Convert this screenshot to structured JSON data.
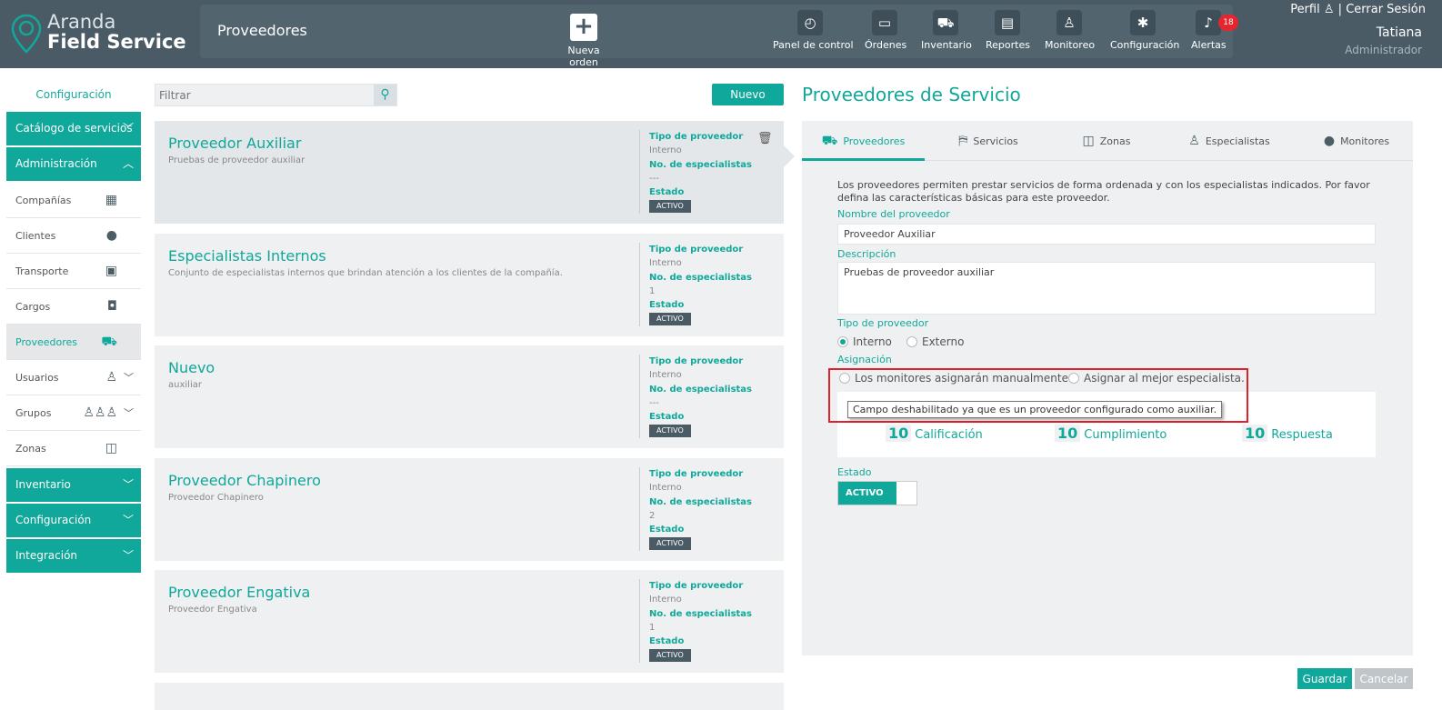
{
  "app": {
    "logo_line1": "Aranda",
    "logo_line2": "Field Service"
  },
  "header": {
    "page_title": "Proveedores",
    "new_order": "Nueva orden",
    "nav": [
      {
        "label": "Panel de control",
        "icon": "dashboard-icon"
      },
      {
        "label": "Órdenes",
        "icon": "orders-icon"
      },
      {
        "label": "Inventario",
        "icon": "inventory-icon"
      },
      {
        "label": "Reportes",
        "icon": "reports-icon"
      },
      {
        "label": "Monitoreo",
        "icon": "monitoring-icon"
      },
      {
        "label": "Configuración",
        "icon": "gear-icon"
      },
      {
        "label": "Alertas",
        "icon": "bell-icon"
      }
    ],
    "alerts_count": "18",
    "profile": "Perfil",
    "separator": "|",
    "logout": "Cerrar Sesión",
    "user_name": "Tatiana",
    "user_role": "Administrador"
  },
  "sidebar": {
    "config_link": "Configuración",
    "catalog": "Catálogo de servicios",
    "admin": "Administración",
    "items": [
      {
        "label": "Compañías",
        "icon": "building-icon"
      },
      {
        "label": "Clientes",
        "icon": "user-icon"
      },
      {
        "label": "Transporte",
        "icon": "bus-icon"
      },
      {
        "label": "Cargos",
        "icon": "briefcase-icon"
      },
      {
        "label": "Proveedores",
        "icon": "cart-icon"
      },
      {
        "label": "Usuarios",
        "icon": "person-icon"
      },
      {
        "label": "Grupos",
        "icon": "group-icon"
      },
      {
        "label": "Zonas",
        "icon": "map-icon"
      }
    ],
    "inventario": "Inventario",
    "configuracion": "Configuración",
    "integracion": "Integración"
  },
  "list": {
    "filter_placeholder": "Filtrar",
    "new_button": "Nuevo",
    "label_tipo": "Tipo de proveedor",
    "label_num": "No. de especialistas",
    "label_estado": "Estado",
    "cards": [
      {
        "title": "Proveedor Auxiliar",
        "desc": "Pruebas de proveedor auxiliar",
        "tipo": "Interno",
        "num": "---",
        "estado": "ACTIVO"
      },
      {
        "title": "Especialistas Internos",
        "desc": "Conjunto de especialistas internos que brindan atención a los clientes de la compañía.",
        "tipo": "Interno",
        "num": "1",
        "estado": "ACTIVO"
      },
      {
        "title": "Nuevo",
        "desc": "auxiliar",
        "tipo": "Interno",
        "num": "---",
        "estado": "ACTIVO"
      },
      {
        "title": "Proveedor Chapinero",
        "desc": "Proveedor Chapinero",
        "tipo": "Interno",
        "num": "2",
        "estado": "ACTIVO"
      },
      {
        "title": "Proveedor Engativa",
        "desc": "Proveedor Engativa",
        "tipo": "Interno",
        "num": "1",
        "estado": "ACTIVO"
      }
    ]
  },
  "detail": {
    "title": "Proveedores de Servicio",
    "tabs": [
      "Proveedores",
      "Servicios",
      "Zonas",
      "Especialistas",
      "Monitores"
    ],
    "intro": "Los proveedores permiten prestar servicios de forma ordenada y con los especialistas indicados. Por favor defina las características básicas para este proveedor.",
    "name_label": "Nombre del proveedor",
    "name_value": "Proveedor Auxiliar",
    "desc_label": "Descripción",
    "desc_value": "Pruebas de proveedor auxiliar",
    "tipo_label": "Tipo de proveedor",
    "tipo_interno": "Interno",
    "tipo_externo": "Externo",
    "asig_label": "Asignación",
    "asig_manual": "Los monitores asignarán manualmente.",
    "asig_best": "Asignar al mejor especialista.",
    "tooltip": "Campo deshabilitado ya que es un proveedor configurado como auxiliar.",
    "metrics": [
      {
        "value": "10",
        "label": "Calificación"
      },
      {
        "value": "10",
        "label": "Cumplimiento"
      },
      {
        "value": "10",
        "label": "Respuesta"
      }
    ],
    "estado_label": "Estado",
    "estado_value": "ACTIVO",
    "save": "Guardar",
    "cancel": "Cancelar"
  },
  "colors": {
    "accent": "#0fa89a",
    "header": "#4a5b66",
    "alert": "#e5262f"
  }
}
